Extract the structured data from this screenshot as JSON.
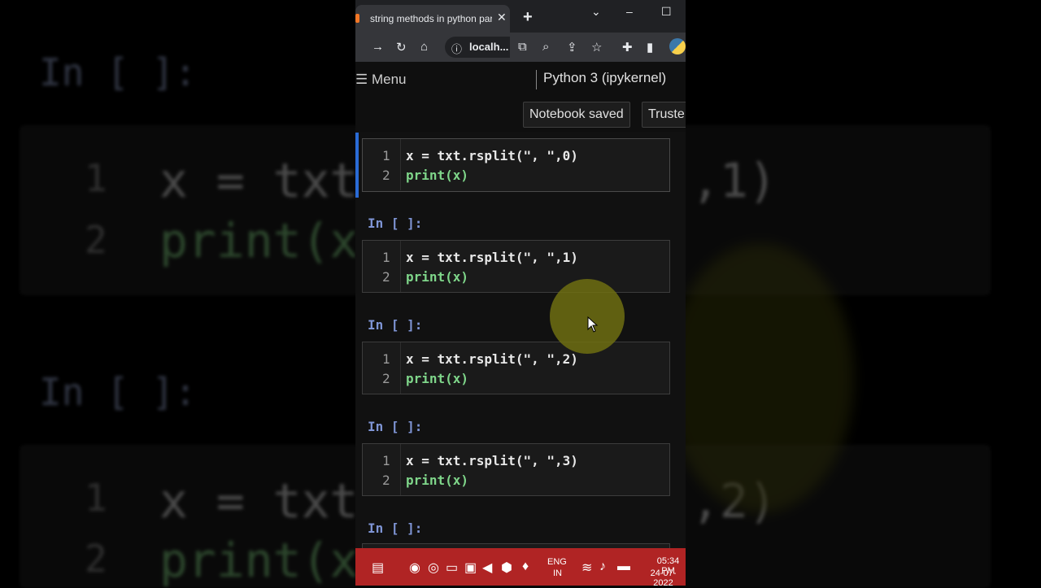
{
  "background": {
    "prompt": "In [ ]:",
    "line1": "x = txt",
    "line2": "print(x",
    "suffix_top": ",1)",
    "suffix_bottom": ",2)",
    "num1": "1",
    "num2": "2"
  },
  "browser": {
    "tab_title": "string methods in python part",
    "tab_close": "✕",
    "new_tab": "+",
    "url_text": "localh...",
    "window_controls": [
      "⌄",
      "–",
      "☐"
    ]
  },
  "notebook": {
    "menu_label": "☰ Menu",
    "kernel_label": "Python 3 (ipykernel)",
    "saved_label": "Notebook saved",
    "trusted_label": "Truste",
    "prompt": "In [ ]:",
    "cells": [
      {
        "line1": "x = txt.rsplit(\", \",0)",
        "line2": "print(x)"
      },
      {
        "line1": "x = txt.rsplit(\", \",1)",
        "line2": "print(x)"
      },
      {
        "line1": "x = txt.rsplit(\", \",2)",
        "line2": "print(x)"
      },
      {
        "line1": "x = txt.rsplit(\", \",3)",
        "line2": "print(x)"
      }
    ],
    "line_numbers": [
      "1",
      "2"
    ]
  },
  "taskbar": {
    "lang_line1": "ENG",
    "lang_line2": "IN",
    "time": "05:34 PM",
    "date": "24-07-2022"
  },
  "colors": {
    "taskbar": "#b02424",
    "accent": "#2a6bd6",
    "highlight": "#6f6f12"
  }
}
